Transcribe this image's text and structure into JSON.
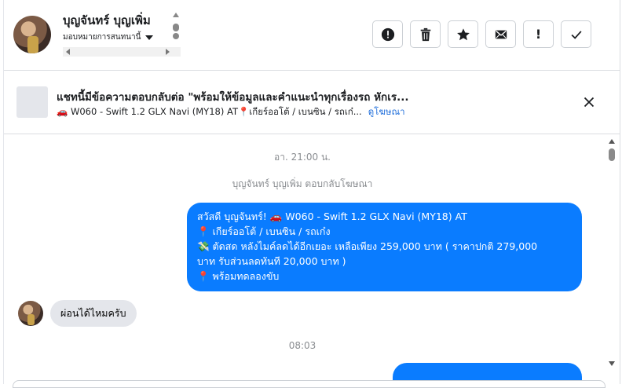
{
  "header": {
    "contact_name": "บุญจันทร์ บุญเพิ่ม",
    "assign_label": "มอบหมายการสนทนานี้",
    "actions": [
      {
        "icon": "alert-circle-icon",
        "label": ""
      },
      {
        "icon": "trash-icon",
        "label": ""
      },
      {
        "icon": "star-icon",
        "label": ""
      },
      {
        "icon": "envelope-icon",
        "label": ""
      },
      {
        "icon": "exclamation-icon",
        "label": "!"
      },
      {
        "icon": "checkmark-icon",
        "label": ""
      }
    ]
  },
  "ad": {
    "title": "แชทนี้มีข้อความตอบกลับต่อ \"พร้อมให้ข้อมูลและคำแนะนำทุกเรื่องรถ หักเร...",
    "subtitle": "🚗 W060 - Swift 1.2 GLX Navi (MY18) AT📍เกียร์ออโต้ / เบนซิน / รถเก๋...",
    "link": "ดูโฆษณา"
  },
  "conversation": {
    "timestamp_1": "อา. 21:00 น.",
    "reply_notice": "บุญจันทร์ บุญเพิ่ม ตอบกลับโฆษณา",
    "outgoing_lines": [
      "สวัสดี บุญจันทร์! 🚗 W060 - Swift 1.2 GLX Navi (MY18) AT",
      "📍 เกียร์ออโต้ / เบนซิน / รถเก๋ง",
      "💸 ตัดสด หลังไมค์ลดได้อีกเยอะ เหลือเพียง 259,000 บาท ( ราคาปกติ 279,000",
      "บาท รับส่วนลดทันที 20,000 บาท )",
      "📍 พร้อมทดลองขับ"
    ],
    "incoming_message": "ผ่อนได้ไหมครับ",
    "timestamp_2": "08:03"
  },
  "colors": {
    "accent": "#0a7cff",
    "link": "#216fdb",
    "incoming_bubble": "#e4e6eb"
  }
}
